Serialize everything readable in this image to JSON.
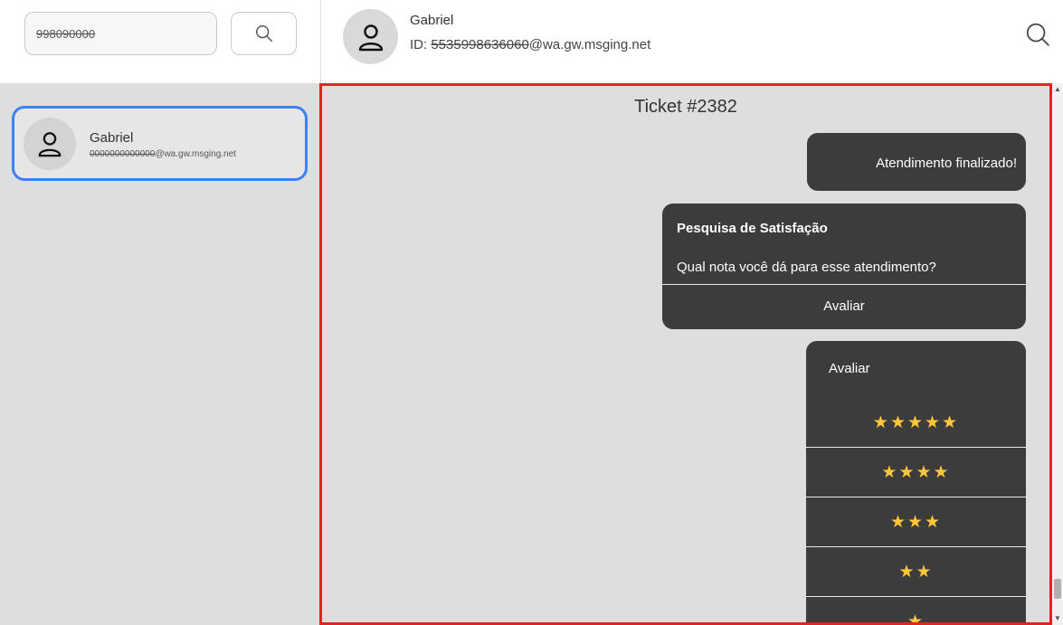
{
  "search": {
    "value": "998090000"
  },
  "header": {
    "name": "Gabriel",
    "id_prefix": "ID: ",
    "id_masked": "5535998636060",
    "id_domain": "@wa.gw.msging.net"
  },
  "sidebar": {
    "contacts": [
      {
        "name": "Gabriel",
        "id_masked": "0000000000000",
        "id_domain": "@wa.gw.msging.net"
      }
    ]
  },
  "chat": {
    "ticket_title": "Ticket #2382",
    "messages": {
      "finished": "Atendimento finalizado!",
      "survey_title": "Pesquisa de Satisfação",
      "survey_question": "Qual nota você dá para esse atendimento?",
      "survey_button": "Avaliar",
      "rating_title": "Avaliar",
      "rating_options": [
        "★★★★★",
        "★★★★",
        "★★★",
        "★★",
        "★"
      ]
    }
  },
  "colors": {
    "accent_blue": "#3b82f6",
    "highlight_red": "#e52222",
    "bubble_bg": "#3c3c3c",
    "star": "#ffc83a"
  },
  "icons": {
    "search": "search-icon",
    "avatar": "user-icon",
    "scroll_up": "arrow-up-icon",
    "scroll_down": "arrow-down-icon"
  }
}
